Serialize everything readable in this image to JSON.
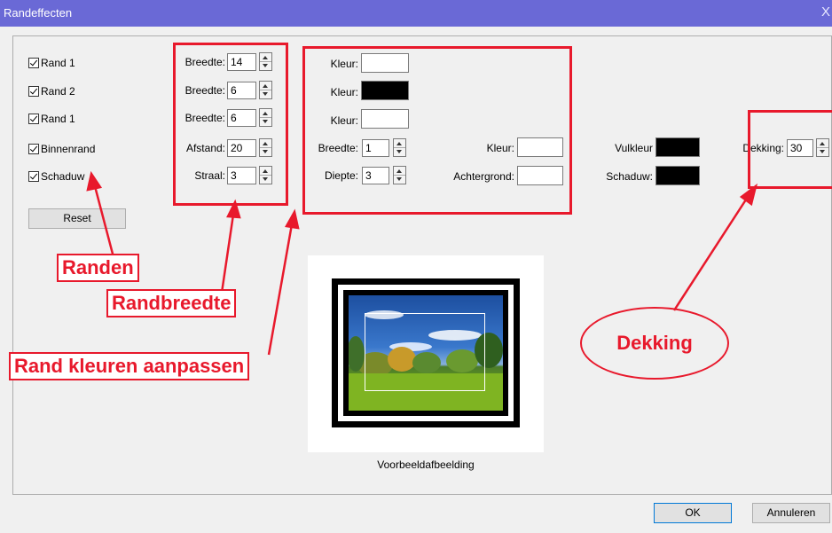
{
  "window": {
    "title": "Randeffecten",
    "close_glyph": "X"
  },
  "borders": [
    {
      "label": "Rand 1",
      "checked": true,
      "width_label": "Breedte:",
      "width_value": "14",
      "color_label": "Kleur:",
      "color": "#ffffff"
    },
    {
      "label": "Rand 2",
      "checked": true,
      "width_label": "Breedte:",
      "width_value": "6",
      "color_label": "Kleur:",
      "color": "#000000"
    },
    {
      "label": "Rand 1",
      "checked": true,
      "width_label": "Breedte:",
      "width_value": "6",
      "color_label": "Kleur:",
      "color": "#ffffff"
    }
  ],
  "inner_border": {
    "label": "Binnenrand",
    "checked": true,
    "distance_label": "Afstand:",
    "distance_value": "20",
    "width_label": "Breedte:",
    "width_value": "1",
    "color_label": "Kleur:",
    "color": "#ffffff",
    "fill_label": "Vulkleur",
    "fill_color": "#000000",
    "opacity_label": "Dekking:",
    "opacity_value": "30"
  },
  "shadow": {
    "label": "Schaduw",
    "checked": true,
    "radius_label": "Straal:",
    "radius_value": "3",
    "depth_label": "Diepte:",
    "depth_value": "3",
    "background_label": "Achtergrond:",
    "background_color": "#ffffff",
    "shadow_label": "Schaduw:",
    "shadow_color": "#000000"
  },
  "reset_label": "Reset",
  "preview_caption": "Voorbeeldafbeelding",
  "buttons": {
    "ok": "OK",
    "cancel": "Annuleren"
  },
  "annotations": {
    "randen": "Randen",
    "randbreedte": "Randbreedte",
    "rand_kleuren": "Rand kleuren aanpassen",
    "dekking": "Dekking"
  },
  "colors": {
    "accent_red": "#e8192c",
    "titlebar": "#6a69d6"
  }
}
